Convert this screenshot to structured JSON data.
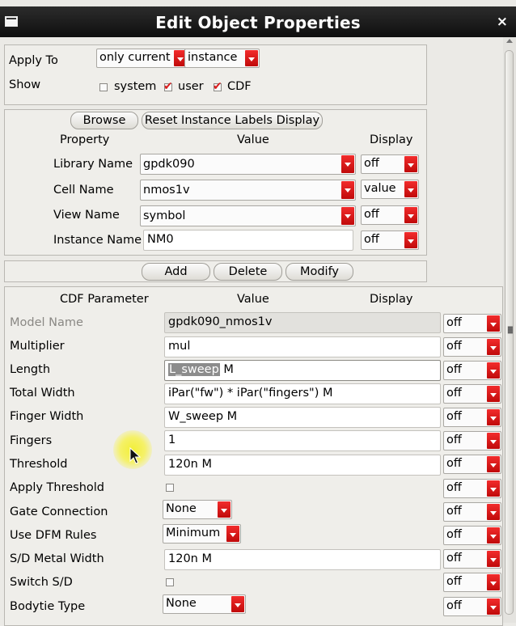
{
  "window": {
    "title": "Edit Object Properties",
    "close_glyph": "×"
  },
  "apply_to": {
    "label": "Apply To",
    "scope_value": "only current",
    "target_value": "instance"
  },
  "show": {
    "label": "Show",
    "options": [
      {
        "label": "system",
        "checked": false
      },
      {
        "label": "user",
        "checked": true
      },
      {
        "label": "CDF",
        "checked": true
      }
    ]
  },
  "instance_section": {
    "browse_label": "Browse",
    "reset_label": "Reset Instance Labels Display",
    "headers": {
      "property": "Property",
      "value": "Value",
      "display": "Display"
    },
    "rows": [
      {
        "label": "Library Name",
        "value": "gpdk090",
        "display": "off"
      },
      {
        "label": "Cell Name",
        "value": "nmos1v",
        "display": "value"
      },
      {
        "label": "View Name",
        "value": "symbol",
        "display": "off"
      },
      {
        "label": "Instance Name",
        "value": "NM0",
        "display": "off"
      }
    ]
  },
  "actions": {
    "add": "Add",
    "delete": "Delete",
    "modify": "Modify"
  },
  "cdf_section": {
    "headers": {
      "param": "CDF Parameter",
      "value": "Value",
      "display": "Display"
    },
    "rows": [
      {
        "label": "Model Name",
        "value": "gpdk090_nmos1v",
        "display": "off"
      },
      {
        "label": "Multiplier",
        "value": "mul",
        "display": "off"
      },
      {
        "label": "Length",
        "value_selected": "L_sweep",
        "value_rest": " M",
        "display": "off"
      },
      {
        "label": "Total Width",
        "value": "iPar(\"fw\") * iPar(\"fingers\") M",
        "display": "off"
      },
      {
        "label": "Finger Width",
        "value": "W_sweep M",
        "display": "off"
      },
      {
        "label": "Fingers",
        "value": "1",
        "display": "off"
      },
      {
        "label": "Threshold",
        "value": "120n M",
        "display": "off"
      },
      {
        "label": "Apply Threshold",
        "checked": false,
        "display": "off"
      },
      {
        "label": "Gate Connection",
        "value": "None",
        "display": "off"
      },
      {
        "label": "Use DFM Rules",
        "value": "Minimum",
        "display": "off"
      },
      {
        "label": "S/D Metal Width",
        "value": "120n M",
        "display": "off"
      },
      {
        "label": "Switch S/D",
        "checked": false,
        "display": "off"
      },
      {
        "label": "Bodytie Type",
        "value": "None",
        "display": "off"
      }
    ]
  },
  "icons": {
    "window_menu": "window-menu-icon",
    "close": "close-icon",
    "dropdown": "chevron-down-icon",
    "check": "check-icon",
    "cursor": "pointer-cursor-icon"
  },
  "colors": {
    "title_bg": "#111111",
    "dropdown_arrow": "#e01515",
    "check_mark": "#d81e1e"
  }
}
